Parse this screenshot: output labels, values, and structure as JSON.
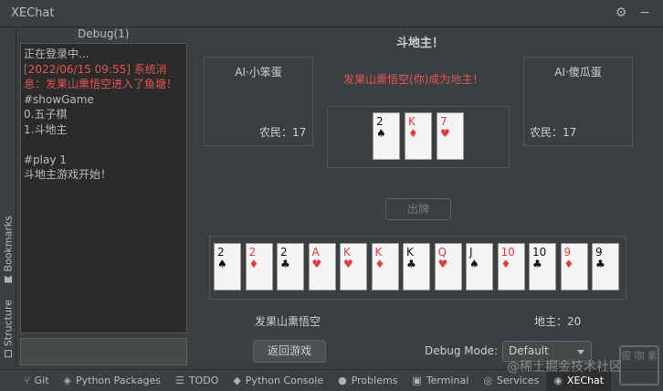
{
  "window": {
    "title": "XEChat",
    "settings_icon": "gear-icon",
    "minimize_icon": "minimize-icon"
  },
  "side_tabs": [
    {
      "label": "Bookmarks",
      "icon": "bookmark-icon"
    },
    {
      "label": "Structure",
      "icon": "structure-icon"
    }
  ],
  "debug": {
    "title": "Debug(1)",
    "lines": [
      {
        "text": "正在登录中...",
        "color": "normal"
      },
      {
        "text": "[2022/06/15 09:55] 系统消息：发果山熏悟空进入了鱼塘！",
        "color": "red"
      },
      {
        "text": "#showGame",
        "color": "normal"
      },
      {
        "text": "0.五子棋",
        "color": "normal"
      },
      {
        "text": "1.斗地主",
        "color": "normal"
      },
      {
        "text": " ",
        "color": "normal"
      },
      {
        "text": "#play 1",
        "color": "normal"
      },
      {
        "text": "斗地主游戏开始！",
        "color": "normal"
      }
    ],
    "input_value": ""
  },
  "game": {
    "title": "斗地主！",
    "announcement": "发果山熏悟空(你)成为地主！",
    "left_ai": {
      "name": "AI·小笨蛋",
      "role_label": "农民：17"
    },
    "right_ai": {
      "name": "AI·傻瓜蛋",
      "role_label": "农民：17"
    },
    "bottom_cards": [
      {
        "rank": "2",
        "suit": "♠",
        "color": "black"
      },
      {
        "rank": "K",
        "suit": "♦",
        "color": "red"
      },
      {
        "rank": "7",
        "suit": "♥",
        "color": "red"
      }
    ],
    "play_button": "出牌",
    "hand": [
      {
        "rank": "2",
        "suit": "♠",
        "color": "black"
      },
      {
        "rank": "2",
        "suit": "♦",
        "color": "red"
      },
      {
        "rank": "2",
        "suit": "♣",
        "color": "black"
      },
      {
        "rank": "A",
        "suit": "♥",
        "color": "red"
      },
      {
        "rank": "K",
        "suit": "♥",
        "color": "red"
      },
      {
        "rank": "K",
        "suit": "♦",
        "color": "red"
      },
      {
        "rank": "K",
        "suit": "♣",
        "color": "black"
      },
      {
        "rank": "Q",
        "suit": "♥",
        "color": "red"
      },
      {
        "rank": "J",
        "suit": "♠",
        "color": "black"
      },
      {
        "rank": "10",
        "suit": "♦",
        "color": "red"
      },
      {
        "rank": "10",
        "suit": "♣",
        "color": "black"
      },
      {
        "rank": "9",
        "suit": "♦",
        "color": "red"
      },
      {
        "rank": "9",
        "suit": "♣",
        "color": "black"
      }
    ],
    "player_name": "发果山熏悟空",
    "landlord_label": "地主：20",
    "back_button": "返回游戏",
    "debug_mode_label": "Debug Mode:",
    "debug_mode_value": "Default"
  },
  "statusbar": [
    {
      "label": "Git",
      "icon": "git-branch-icon",
      "active": false
    },
    {
      "label": "Python Packages",
      "icon": "packages-icon",
      "active": false
    },
    {
      "label": "TODO",
      "icon": "todo-list-icon",
      "active": false
    },
    {
      "label": "Python Console",
      "icon": "python-icon",
      "active": false
    },
    {
      "label": "Problems",
      "icon": "problems-icon",
      "active": false
    },
    {
      "label": "Terminal",
      "icon": "terminal-icon",
      "active": false
    },
    {
      "label": "Services",
      "icon": "services-icon",
      "active": false
    },
    {
      "label": "XEChat",
      "icon": "chat-icon",
      "active": true
    }
  ],
  "watermark": {
    "text": "@稀土掘金技术社区",
    "seal_text": "掘 咖 紫"
  },
  "colors": {
    "background": "#3c3f41",
    "panel": "#2b2b2b",
    "red_text": "#e05555",
    "card_red": "#e23b3b"
  }
}
